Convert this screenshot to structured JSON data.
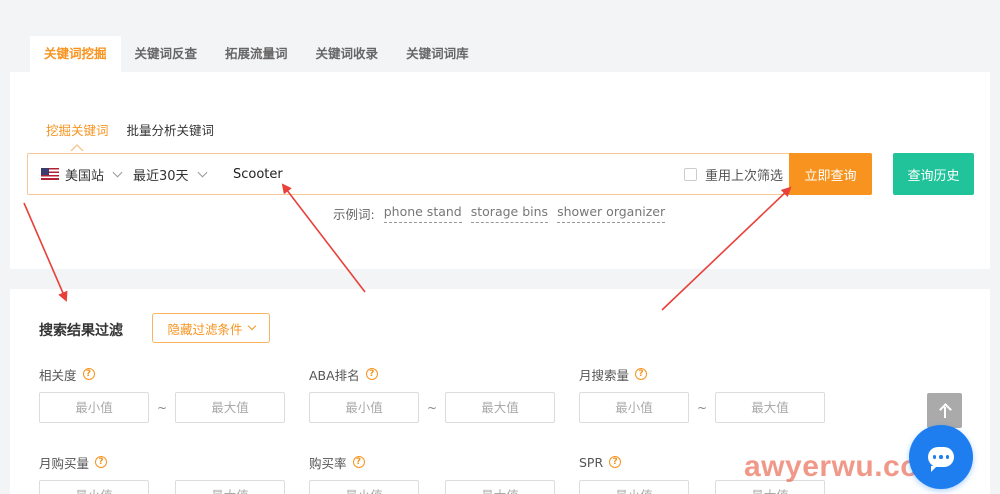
{
  "top_tabs": [
    {
      "label": "关键词挖掘",
      "active": true
    },
    {
      "label": "关键词反查",
      "active": false
    },
    {
      "label": "拓展流量词",
      "active": false
    },
    {
      "label": "关键词收录",
      "active": false
    },
    {
      "label": "关键词词库",
      "active": false
    }
  ],
  "search": {
    "sub_tabs": [
      {
        "label": "挖掘关键词",
        "active": true
      },
      {
        "label": "批量分析关键词",
        "active": false
      }
    ],
    "site": "美国站",
    "site_flag_icon": "us-flag-icon",
    "period": "最近30天",
    "keyword": "Scooter",
    "reuse_filter_label": "重用上次筛选",
    "query_label": "立即查询",
    "history_label": "查询历史",
    "examples_label": "示例词:",
    "examples": [
      "phone stand",
      "storage bins",
      "shower organizer"
    ]
  },
  "filters": {
    "title": "搜索结果过滤",
    "hide_label": "隐藏过滤条件",
    "min_placeholder": "最小值",
    "max_placeholder": "最大值",
    "range_separator": "~",
    "help_glyph": "?",
    "groups": [
      {
        "label": "相关度"
      },
      {
        "label": "ABA排名"
      },
      {
        "label": "月搜索量"
      },
      {
        "label": "月购买量"
      },
      {
        "label": "购买率"
      },
      {
        "label": "SPR"
      }
    ]
  },
  "watermark": "awyerwu.com",
  "colors": {
    "accent": "#f7931e",
    "history_button": "#20c39a",
    "chat_button": "#1e7ef0",
    "annotation_arrow": "#e8413a"
  }
}
